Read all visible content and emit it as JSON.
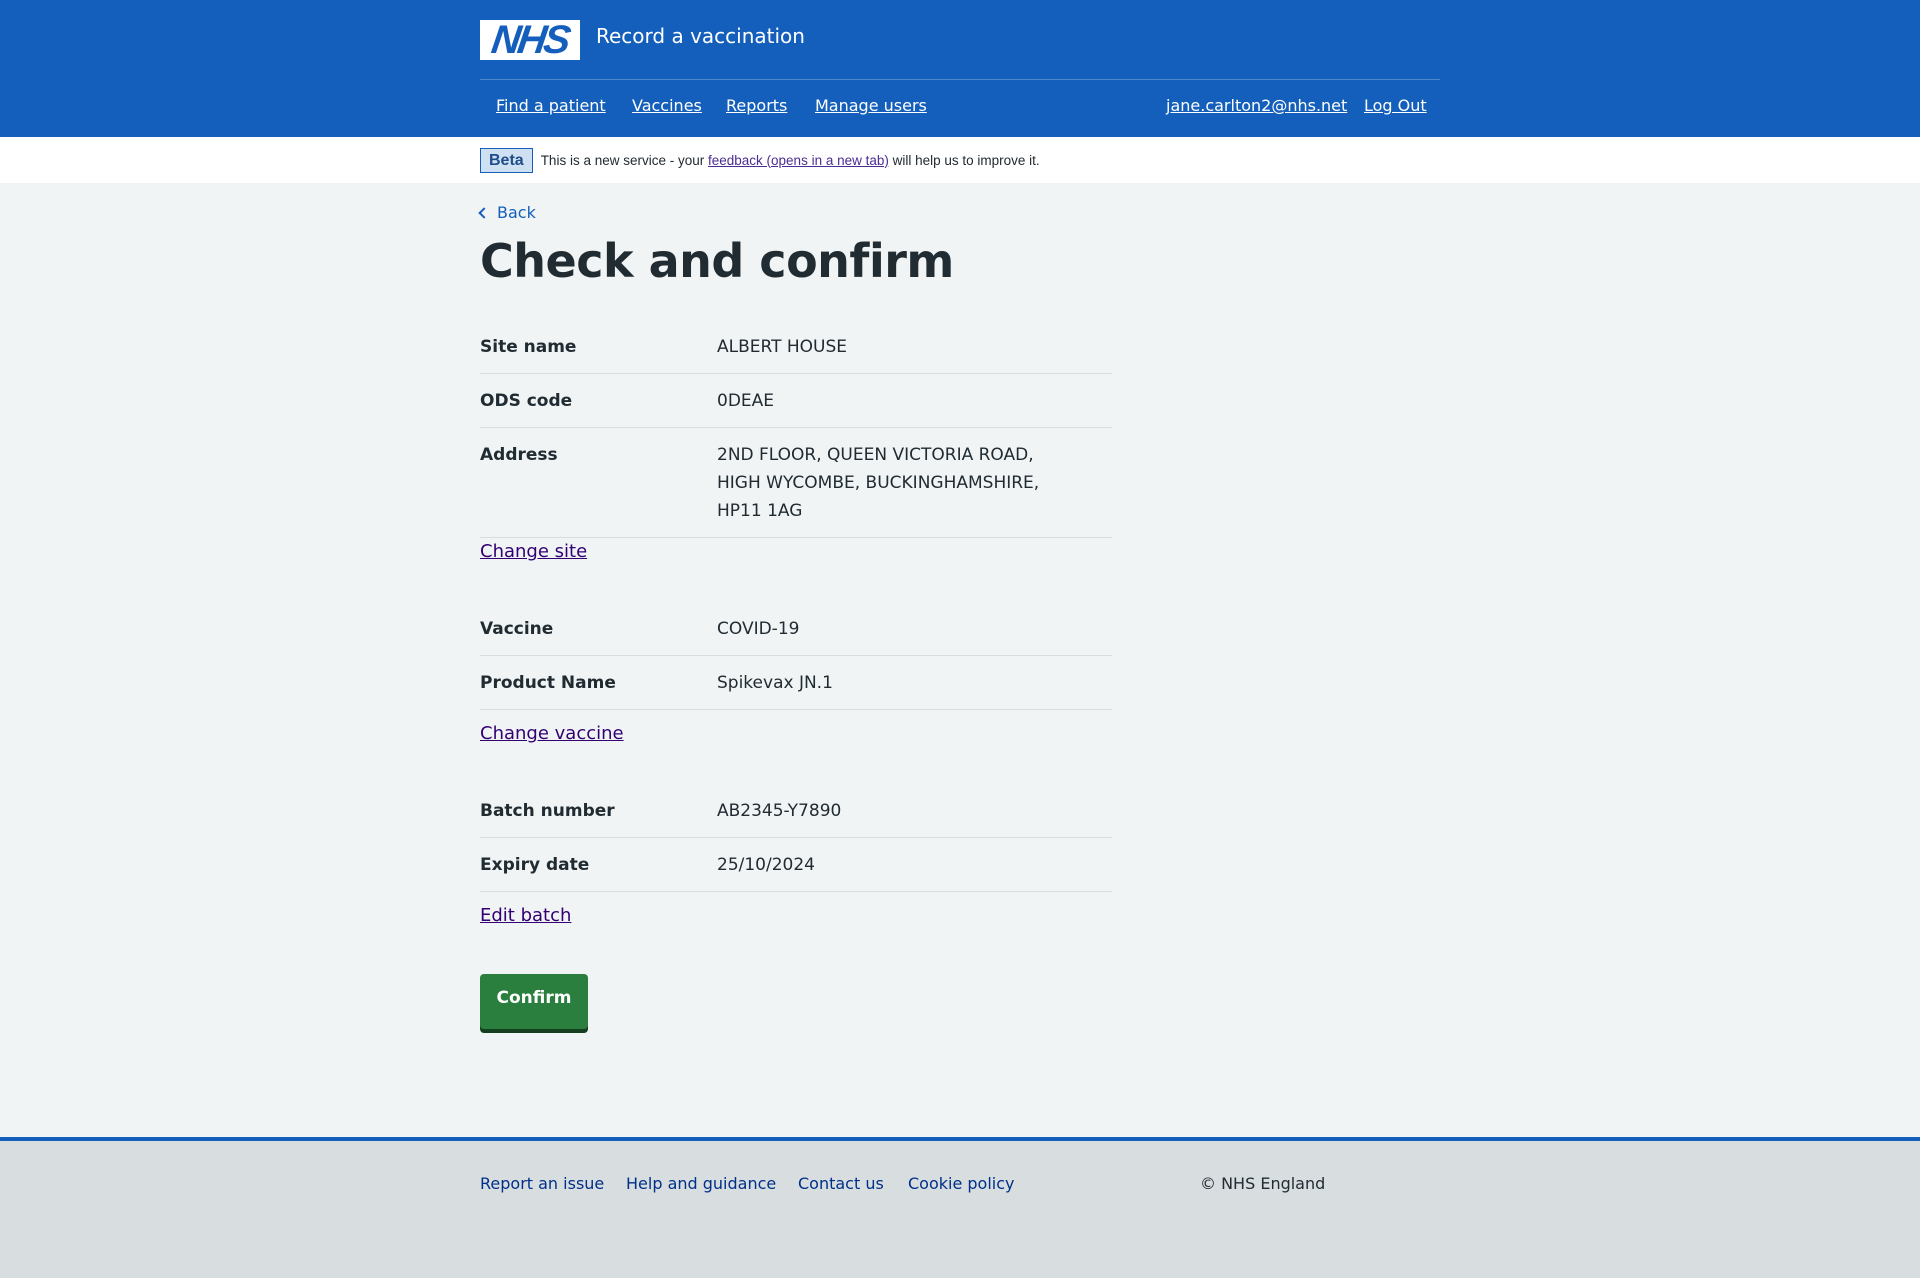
{
  "header": {
    "logo_text": "NHS",
    "service_name": "Record a vaccination",
    "nav": [
      {
        "label": "Find a patient"
      },
      {
        "label": "Vaccines"
      },
      {
        "label": "Reports"
      },
      {
        "label": "Manage users"
      }
    ],
    "user_email": "jane.carlton2@nhs.net",
    "logout_label": "Log Out"
  },
  "beta": {
    "tag": "Beta",
    "text_before": "This is a new service - your ",
    "link": "feedback (opens in a new tab)",
    "text_after": " will help us to improve it."
  },
  "main": {
    "back_label": "Back",
    "heading": "Check and confirm",
    "site": {
      "rows": [
        {
          "key": "Site name",
          "value": "ALBERT HOUSE"
        },
        {
          "key": "ODS code",
          "value": "0DEAE"
        },
        {
          "key": "Address",
          "value": "2ND FLOOR, QUEEN VICTORIA ROAD, HIGH WYCOMBE, BUCKINGHAMSHIRE, HP11 1AG"
        }
      ],
      "change_label": "Change site"
    },
    "vaccine": {
      "rows": [
        {
          "key": "Vaccine",
          "value": "COVID-19"
        },
        {
          "key": "Product Name",
          "value": "Spikevax JN.1"
        }
      ],
      "change_label": "Change vaccine"
    },
    "batch": {
      "rows": [
        {
          "key": "Batch number",
          "value": "AB2345-Y7890"
        },
        {
          "key": "Expiry date",
          "value": "25/10/2024"
        }
      ],
      "change_label": "Edit batch"
    },
    "confirm_label": "Confirm"
  },
  "footer": {
    "links": [
      {
        "label": "Report an issue"
      },
      {
        "label": "Help and guidance"
      },
      {
        "label": "Contact us"
      },
      {
        "label": "Cookie policy"
      }
    ],
    "copyright": "© NHS England"
  },
  "colors": {
    "brand_blue": "#145fbb",
    "confirm_green": "#2a7f3e",
    "visited_link": "#330072",
    "page_bg": "#f0f4f5",
    "footer_bg": "#d8dde0"
  }
}
